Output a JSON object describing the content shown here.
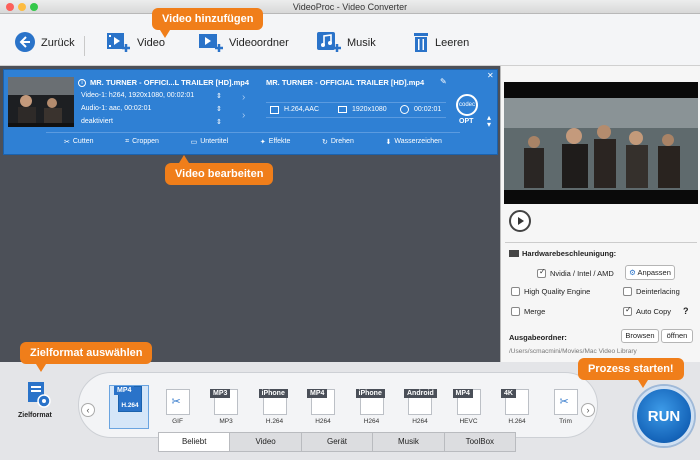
{
  "window": {
    "title": "VideoProc - Video Converter"
  },
  "toolbar": {
    "back_label": "Zurück",
    "video_label": "Video",
    "folder_label": "Videoordner",
    "music_label": "Musik",
    "clear_label": "Leeren"
  },
  "callouts": {
    "add_video": "Video hinzufügen",
    "edit_video": "Video bearbeiten",
    "choose_format": "Zielformat auswählen",
    "start_process": "Prozess starten!"
  },
  "file": {
    "source_name": "MR. TURNER - OFFICI...L TRAILER [HD].mp4",
    "video_track": "Video-1: h264, 1920x1080, 00:02:01",
    "audio_track": "Audio-1: aac, 00:02:01",
    "subtitle_state": "deaktiviert",
    "target_name": "MR. TURNER - OFFICIAL TRAILER [HD].mp4",
    "target_codec": "H.264,AAC",
    "target_resolution": "1920x1080",
    "target_duration": "00:02:01",
    "codec_badge": "codec",
    "opt_label": "OPT"
  },
  "edit_tools": {
    "cut": "Cutten",
    "crop": "Croppen",
    "subtitle": "Untertitel",
    "effects": "Effekte",
    "rotate": "Drehen",
    "watermark": "Wasserzeichen"
  },
  "settings": {
    "hw_title": "Hardwarebeschleunigung:",
    "nvidia_label": "Nvidia / Intel / AMD",
    "nvidia_checked": true,
    "adjust_button": "Anpassen",
    "high_quality_label": "High Quality Engine",
    "high_quality_checked": false,
    "deinterlacing_label": "Deinterlacing",
    "deinterlacing_checked": false,
    "merge_label": "Merge",
    "merge_checked": false,
    "autocopy_label": "Auto Copy",
    "autocopy_checked": true,
    "help_label": "?",
    "output_title": "Ausgabeordner:",
    "output_path": "/Users/scmacmini/Movies/Mac Video Library",
    "browse_button": "Browsen",
    "open_button": "öffnen"
  },
  "target_format": {
    "label": "Zielformat"
  },
  "formats": [
    {
      "tag": "MP4",
      "sub": "H.264",
      "selected": true
    },
    {
      "tag": "",
      "sub": "GIF",
      "selected": false
    },
    {
      "tag": "MP3",
      "sub": "MP3",
      "selected": false
    },
    {
      "tag": "iPhone",
      "sub": "H.264",
      "selected": false
    },
    {
      "tag": "MP4",
      "sub": "H264",
      "selected": false
    },
    {
      "tag": "iPhone",
      "sub": "H264",
      "selected": false
    },
    {
      "tag": "Android",
      "sub": "H264",
      "selected": false
    },
    {
      "tag": "MP4",
      "sub": "HEVC",
      "selected": false
    },
    {
      "tag": "4K",
      "sub": "H.264",
      "selected": false
    },
    {
      "tag": "",
      "sub": "Trim",
      "selected": false
    }
  ],
  "tabs": [
    "Beliebt",
    "Video",
    "Gerät",
    "Musik",
    "ToolBox"
  ],
  "active_tab": 0,
  "run_label": "RUN",
  "nav": {
    "prev": "‹",
    "next": "›"
  },
  "colors": {
    "accent": "#2f80d4",
    "callout": "#f07e1a",
    "run": "#1a6fc4",
    "panel_dark": "#4c5058"
  },
  "icons": {
    "back": "back-arrow-icon",
    "video": "add-video-icon",
    "folder": "add-folder-icon",
    "music": "add-music-icon",
    "clear": "trash-icon"
  }
}
